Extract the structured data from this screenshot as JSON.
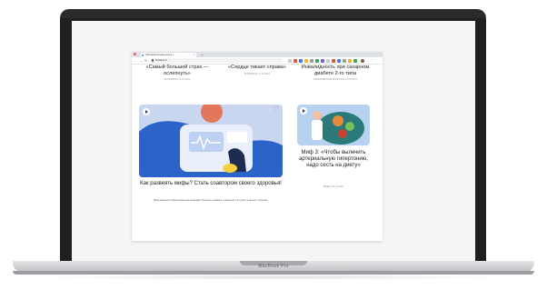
{
  "device": {
    "brand_label": "MacBook Pro"
  },
  "browser": {
    "tab_title": "Образовательная серия «...",
    "address": "flowsanit.ru",
    "new_tab_symbol": "+",
    "tab_close_symbol": "×"
  },
  "articles_top": [
    {
      "title": "«Самый большой страх — ослепнуть»",
      "meta": "ИНТЕРВЬЮ  24.03.2021"
    },
    {
      "title": "«Сердце тикает справа»",
      "meta": "ИНТЕРВЬЮ  24.03.2021"
    },
    {
      "title": "Инвалидность при сахарном диабете 2-го типа",
      "meta": "ЮРИДИЧЕСКИЕ ВОПРОСЫ  24.03.2021"
    }
  ],
  "featured": {
    "title": "Как развеять мифы? Стать соавтором своего здоровья!",
    "description": "Врач-кардиолог Ирина Бекетова призывает больных узнавать о диагнозе и вступать в диалог с врачом.",
    "card_bg": "#c9d6ef",
    "blob_color": "#2b63c9"
  },
  "side_article": {
    "title": "Миф 3: «Чтобы вылечить артериальную гипертонию, надо сесть на диету»",
    "meta": "ВИДЕО  24.03.2021",
    "card_bg": "#b7d2f1"
  },
  "icons": [
    "play-icon",
    "heart-icon",
    "back-icon",
    "forward-icon",
    "reload-icon",
    "lock-icon"
  ]
}
